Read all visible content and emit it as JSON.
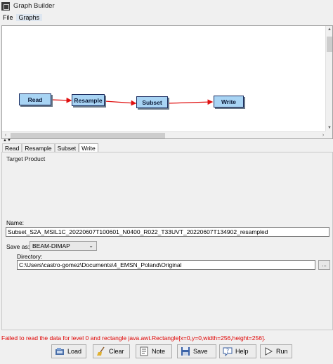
{
  "window": {
    "title": "Graph Builder"
  },
  "menu": {
    "items": [
      "File",
      "Graphs"
    ]
  },
  "graph": {
    "nodes": [
      {
        "label": "Read"
      },
      {
        "label": "Resample"
      },
      {
        "label": "Subset"
      },
      {
        "label": "Write"
      }
    ],
    "edge_color": "#e01010",
    "node_fill": "#a8d4f4"
  },
  "tabs": [
    "Read",
    "Resample",
    "Subset",
    "Write"
  ],
  "active_tab": "Write",
  "write_panel": {
    "section_title": "Target Product",
    "name_label": "Name:",
    "name_value": "Subset_S2A_MSIL1C_20220607T100601_N0400_R022_T33UVT_20220607T134902_resampled",
    "save_as_label": "Save as:",
    "save_as_value": "BEAM-DIMAP",
    "directory_label": "Directory:",
    "directory_value": "C:\\Users\\castro-gomez\\Documents\\4_EMSN_Poland\\Original",
    "browse_label": "..."
  },
  "status": {
    "error": "Failed to read the data for level 0 and rectangle java.awt.Rectangle[x=0,y=0,width=256,height=256].",
    "error_color": "#e00000"
  },
  "buttons": {
    "load": "Load",
    "clear": "Clear",
    "note": "Note",
    "save": "Save",
    "help": "Help",
    "run": "Run"
  }
}
